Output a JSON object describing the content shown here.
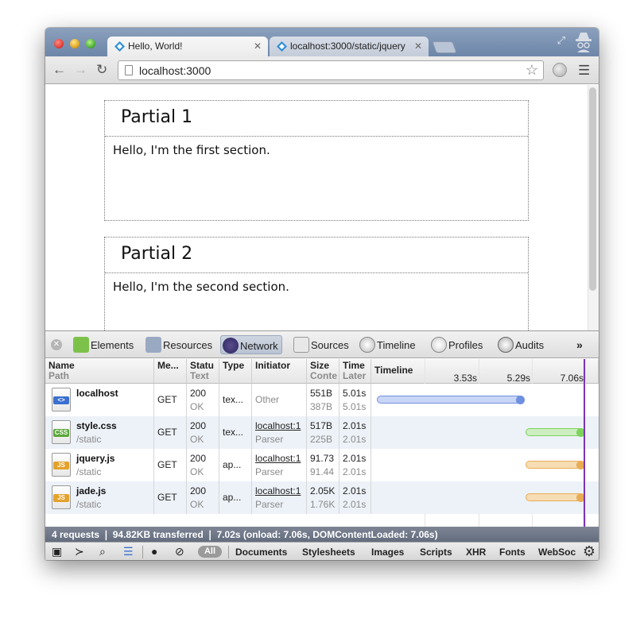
{
  "browser": {
    "tabs": [
      {
        "title": "Hello, World!",
        "active": true
      },
      {
        "title": "localhost:3000/static/jquery",
        "active": false
      }
    ],
    "url": "localhost:3000",
    "icons": {
      "back": "back-arrow-icon",
      "forward": "forward-arrow-icon",
      "reload": "reload-icon",
      "star": "bookmark-star-icon",
      "menu": "hamburger-menu-icon",
      "incognito": "incognito-icon"
    }
  },
  "page": {
    "sections": [
      {
        "heading": "Partial 1",
        "body": "Hello, I'm the first section."
      },
      {
        "heading": "Partial 2",
        "body": "Hello, I'm the second section."
      }
    ]
  },
  "devtools": {
    "panels": [
      "Elements",
      "Resources",
      "Network",
      "Sources",
      "Timeline",
      "Profiles",
      "Audits"
    ],
    "active_panel": "Network",
    "more": "»",
    "columns": [
      {
        "title": "Name",
        "sub": "Path"
      },
      {
        "title": "Me...",
        "sub": ""
      },
      {
        "title": "Statu",
        "sub": "Text"
      },
      {
        "title": "Type",
        "sub": ""
      },
      {
        "title": "Initiator",
        "sub": ""
      },
      {
        "title": "Size",
        "sub": "Conte"
      },
      {
        "title": "Time",
        "sub": "Later"
      },
      {
        "title": "Timeline",
        "sub": ""
      }
    ],
    "timeline_ticks": [
      "3.53s",
      "5.29s",
      "7.06s"
    ],
    "requests": [
      {
        "name": "localhost",
        "path": "",
        "method": "GET",
        "status": "200",
        "status_text": "OK",
        "type": "tex...",
        "initiator": "Other",
        "initiator_sub": "",
        "size": "551B",
        "content": "387B",
        "time": "5.01s",
        "latency": "5.01s",
        "icon_label": "<>",
        "icon_color": "#3b6fd0",
        "bar_color": "#c9d6f5",
        "dot_color": "#6f8fe0",
        "start": 0.0,
        "end": 0.71
      },
      {
        "name": "style.css",
        "path": "/static",
        "method": "GET",
        "status": "200",
        "status_text": "OK",
        "type": "tex...",
        "initiator": "localhost:1",
        "initiator_sub": "Parser",
        "size": "517B",
        "content": "225B",
        "time": "2.01s",
        "latency": "2.01s",
        "icon_label": "CSS",
        "icon_color": "#58a938",
        "bar_color": "#cdeec0",
        "dot_color": "#7cd35c",
        "start": 0.71,
        "end": 1.0
      },
      {
        "name": "jquery.js",
        "path": "/static",
        "method": "GET",
        "status": "200",
        "status_text": "OK",
        "type": "ap...",
        "initiator": "localhost:1",
        "initiator_sub": "Parser",
        "size": "91.73",
        "content": "91.44",
        "time": "2.01s",
        "latency": "2.01s",
        "icon_label": "JS",
        "icon_color": "#e3a22b",
        "bar_color": "#f6ddb3",
        "dot_color": "#e9ac55",
        "start": 0.71,
        "end": 1.0
      },
      {
        "name": "jade.js",
        "path": "/static",
        "method": "GET",
        "status": "200",
        "status_text": "OK",
        "type": "ap...",
        "initiator": "localhost:1",
        "initiator_sub": "Parser",
        "size": "2.05K",
        "content": "1.76K",
        "time": "2.01s",
        "latency": "2.01s",
        "icon_label": "JS",
        "icon_color": "#e3a22b",
        "bar_color": "#f6ddb3",
        "dot_color": "#e9ac55",
        "start": 0.71,
        "end": 1.0
      }
    ],
    "summary": "4 requests  ❘  94.82KB transferred  ❘  7.02s (onload: 7.06s, DOMContentLoaded: 7.06s)",
    "filters": [
      "Documents",
      "Stylesheets",
      "Images",
      "Scripts",
      "XHR",
      "Fonts",
      "WebSoc"
    ],
    "filter_all": "All"
  }
}
